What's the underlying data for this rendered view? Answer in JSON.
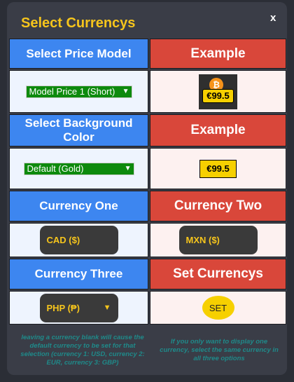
{
  "dialog": {
    "title": "Select Currencys",
    "close_label": "x"
  },
  "headers": {
    "price_model": "Select Price Model",
    "example_1": "Example",
    "background_color": "Select Background Color",
    "example_2": "Example",
    "currency_one": "Currency One",
    "currency_two": "Currency Two",
    "currency_three": "Currency Three",
    "set_currencys": "Set Currencys"
  },
  "selects": {
    "price_model": "Model Price 1 (Short)",
    "background_color": "Default (Gold)"
  },
  "preview": {
    "price_1": "€99.5",
    "price_2": "€99.5",
    "badge_icon": "bitcoin-icon"
  },
  "currencies": {
    "one": "CAD ($)",
    "two": "MXN ($)",
    "three": "PHP (₱)"
  },
  "set_button": "SET",
  "notes": {
    "left": "leaving a currency blank will cause the default currency to be set for that selection (currency 1: USD, currency 2: EUR, currency 3: GBP)",
    "right": "If you only want to display one currency, select the same currency in all three options"
  },
  "colors": {
    "title": "#f6c51c",
    "header_blue": "#3d86f0",
    "header_red": "#d9473a",
    "select_green": "#0d8a0d",
    "price_gold": "#f6d000",
    "note_teal": "#1f8a8a"
  }
}
